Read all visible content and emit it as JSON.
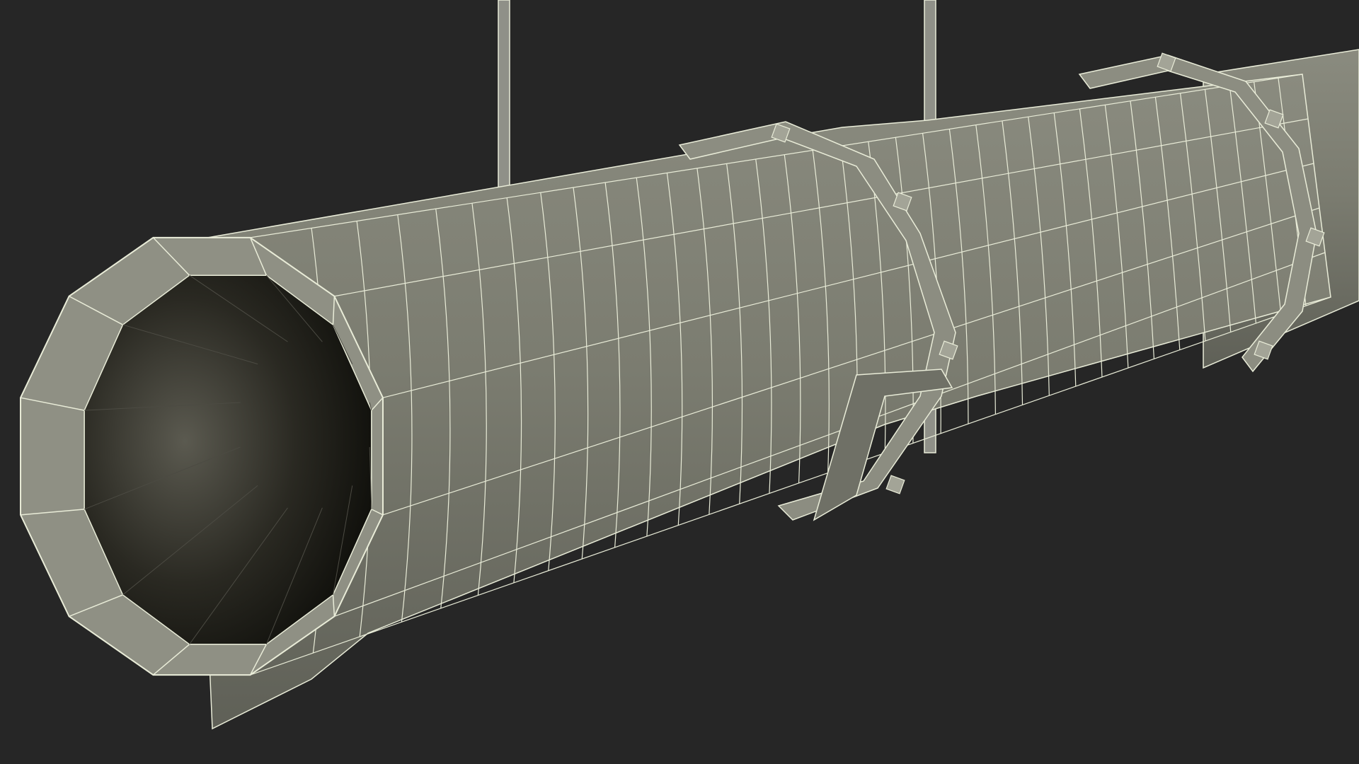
{
  "scene": {
    "background_color": "#262626",
    "duct_color": "#7b7c70",
    "duct_shadow_color": "#5a5b52",
    "wire_color": "#e9ecd8",
    "interior_color": "#15140f",
    "rod_color": "#9c9d94",
    "segments_side": 12
  }
}
